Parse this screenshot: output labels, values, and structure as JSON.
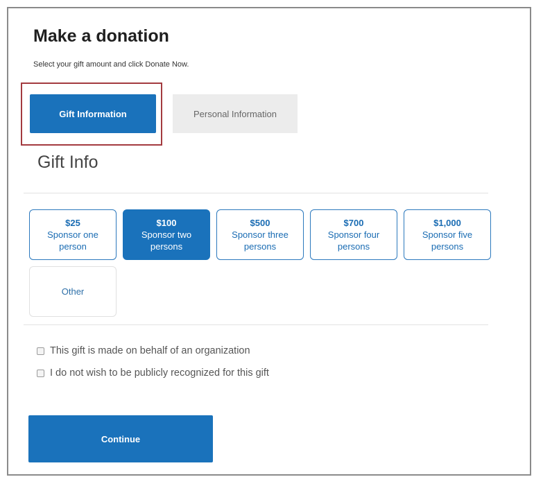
{
  "header": {
    "title": "Make a donation",
    "subtitle": "Select your gift amount and click Donate Now."
  },
  "tabs": [
    {
      "label": "Gift Information",
      "active": true
    },
    {
      "label": "Personal Information",
      "active": false
    }
  ],
  "section": {
    "title": "Gift Info"
  },
  "amounts": [
    {
      "amount": "$25",
      "line1": "Sponsor one",
      "line2": "person",
      "selected": false
    },
    {
      "amount": "$100",
      "line1": "Sponsor two",
      "line2": "persons",
      "selected": true
    },
    {
      "amount": "$500",
      "line1": "Sponsor three",
      "line2": "persons",
      "selected": false
    },
    {
      "amount": "$700",
      "line1": "Sponsor four",
      "line2": "persons",
      "selected": false
    },
    {
      "amount": "$1,000",
      "line1": "Sponsor five",
      "line2": "persons",
      "selected": false
    }
  ],
  "other_option": {
    "label": "Other"
  },
  "options": [
    {
      "label": "This gift is made on behalf of an organization",
      "checked": false
    },
    {
      "label": "I do not wish to be publicly recognized for this gift",
      "checked": false
    }
  ],
  "continue_label": "Continue",
  "colors": {
    "primary": "#1a72bb",
    "highlight": "#a33a3f",
    "inactive_tab": "#ececec"
  }
}
